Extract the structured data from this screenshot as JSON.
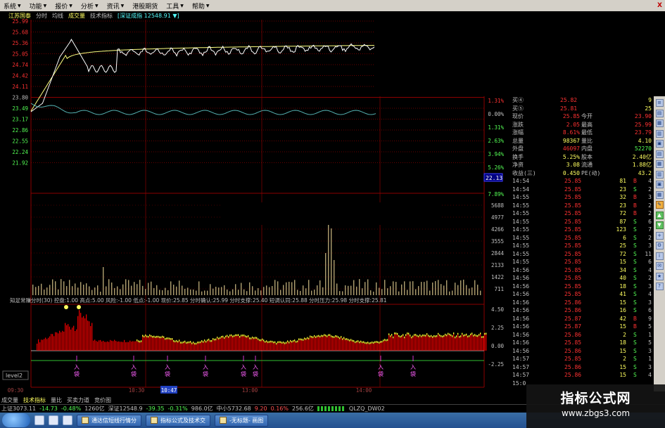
{
  "menu": [
    "系统",
    "功能",
    "报价",
    "分析",
    "资讯",
    "港股期货",
    "工具",
    "帮助"
  ],
  "window_close": "X",
  "chart_header": {
    "stock": "江苏国泰",
    "tabs": [
      "分时",
      "均线",
      "成交量",
      "技术指标"
    ],
    "index_label": "[深证成指 12548.91 ▼]"
  },
  "chart_data": [
    {
      "type": "line",
      "name": "price",
      "price_ticks": [
        "25.99",
        "25.68",
        "25.36",
        "25.05",
        "24.74",
        "24.42",
        "24.11",
        "23.80",
        "23.49",
        "23.17",
        "22.86",
        "22.55",
        "22.24",
        "21.92"
      ],
      "pct_ticks": [
        "1.31%",
        "0.00%",
        "1.31%",
        "2.63%",
        "3.94%",
        "5.26%",
        "",
        "7.89%"
      ],
      "current_value_tag": "22.13",
      "ylim": [
        21.92,
        25.99
      ]
    },
    {
      "type": "bar",
      "name": "volume",
      "ticks": [
        "5688",
        "4977",
        "4266",
        "3555",
        "2844",
        "2133",
        "1422",
        "711"
      ]
    },
    {
      "type": "area",
      "name": "indicator",
      "ticks": [
        "4.50",
        "2.25",
        "0.00",
        "-2.25"
      ],
      "title": "知足常赚分时(30)  控盘:1.00  高点:5.00  风险:-1.00  低点:-1.00  现价:25.85  分时确认:25.99  分时支撑:25.40  短调认同:25.88  分时压力:25.98  分时支撑:25.81",
      "signals": [
        "入袋",
        "入袋",
        "入袋",
        "入袋",
        "入袋",
        "入袋",
        "入袋",
        "入袋",
        "入袋",
        "入袋",
        "入袋"
      ]
    }
  ],
  "time_axis": [
    "09:30",
    "10:30",
    "10:47",
    "13:00",
    "14:00"
  ],
  "level2": "level2",
  "quote": {
    "bid_rows": [
      {
        "label": "买④",
        "price": "25.82",
        "vol": "9"
      },
      {
        "label": "买⑤",
        "price": "25.81",
        "vol": "25"
      }
    ],
    "stats": [
      {
        "l1": "现价",
        "v1": "25.85",
        "l2": "今开",
        "v2": "23.90"
      },
      {
        "l1": "涨跌",
        "v1": "2.05",
        "l2": "最高",
        "v2": "25.99"
      },
      {
        "l1": "涨幅",
        "v1": "8.61%",
        "l2": "最低",
        "v2": "23.79"
      },
      {
        "l1": "总量",
        "v1": "98367",
        "l2": "量比",
        "v2": "4.10"
      },
      {
        "l1": "外盘",
        "v1": "46097",
        "l2": "内盘",
        "v2": "52270"
      },
      {
        "l1": "换手",
        "v1": "5.25%",
        "l2": "股本",
        "v2": "2.40亿"
      },
      {
        "l1": "净资",
        "v1": "3.08",
        "l2": "流通",
        "v2": "1.88亿"
      },
      {
        "l1": "收益(三)",
        "v1": "0.450",
        "l2": "PE(动)",
        "v2": "43.2"
      }
    ],
    "ticks": [
      {
        "t": "14:54",
        "p": "25.85",
        "v": "81",
        "s": "B",
        "n": "4"
      },
      {
        "t": "14:54",
        "p": "25.85",
        "v": "23",
        "s": "S",
        "n": "2"
      },
      {
        "t": "14:55",
        "p": "25.85",
        "v": "32",
        "s": "B",
        "n": "3"
      },
      {
        "t": "14:55",
        "p": "25.85",
        "v": "23",
        "s": "B",
        "n": "2"
      },
      {
        "t": "14:55",
        "p": "25.85",
        "v": "72",
        "s": "B",
        "n": "2"
      },
      {
        "t": "14:55",
        "p": "25.85",
        "v": "87",
        "s": "S",
        "n": "6"
      },
      {
        "t": "14:55",
        "p": "25.85",
        "v": "123",
        "s": "S",
        "n": "7"
      },
      {
        "t": "14:55",
        "p": "25.85",
        "v": "6",
        "s": "S",
        "n": "2"
      },
      {
        "t": "14:55",
        "p": "25.85",
        "v": "25",
        "s": "S",
        "n": "3"
      },
      {
        "t": "14:55",
        "p": "25.85",
        "v": "72",
        "s": "S",
        "n": "11"
      },
      {
        "t": "14:55",
        "p": "25.85",
        "v": "15",
        "s": "S",
        "n": "6"
      },
      {
        "t": "14:56",
        "p": "25.85",
        "v": "34",
        "s": "S",
        "n": "4"
      },
      {
        "t": "14:56",
        "p": "25.85",
        "v": "40",
        "s": "S",
        "n": "2"
      },
      {
        "t": "14:56",
        "p": "25.85",
        "v": "18",
        "s": "S",
        "n": "3"
      },
      {
        "t": "14:56",
        "p": "25.85",
        "v": "41",
        "s": "S",
        "n": "4"
      },
      {
        "t": "14:56",
        "p": "25.86",
        "v": "15",
        "s": "S",
        "n": "3"
      },
      {
        "t": "14:56",
        "p": "25.86",
        "v": "16",
        "s": "S",
        "n": "6"
      },
      {
        "t": "14:56",
        "p": "25.87",
        "v": "42",
        "s": "B",
        "n": "9"
      },
      {
        "t": "14:56",
        "p": "25.87",
        "v": "15",
        "s": "B",
        "n": "5"
      },
      {
        "t": "14:56",
        "p": "25.86",
        "v": "2",
        "s": "S",
        "n": "1"
      },
      {
        "t": "14:56",
        "p": "25.85",
        "v": "18",
        "s": "S",
        "n": "5"
      },
      {
        "t": "14:56",
        "p": "25.86",
        "v": "15",
        "s": "S",
        "n": "3"
      },
      {
        "t": "14:57",
        "p": "25.85",
        "v": "2",
        "s": "S",
        "n": "1"
      },
      {
        "t": "14:57",
        "p": "25.86",
        "v": "15",
        "s": "S",
        "n": "3"
      },
      {
        "t": "14:57",
        "p": "25.86",
        "v": "15",
        "s": "S",
        "n": "4"
      },
      {
        "t": "15:0",
        "p": "",
        "v": "",
        "s": "",
        "n": ""
      }
    ]
  },
  "bottom_tabs": [
    "成交量",
    "技术指标",
    "量比",
    "买卖力道",
    "竞价图"
  ],
  "status": [
    "上证3073.11",
    "-14.73",
    "-0.48%",
    "1260亿",
    "深证12548.9",
    "-39.35",
    "-0.31%",
    "986.0亿",
    "中小5732.68",
    "9.20",
    "0.16%",
    "256.6亿",
    "QLZQ_DW02"
  ],
  "taskbar": [
    "通达信短线行情分",
    "指标公式及技术交",
    "-无标题- 画图"
  ],
  "watermark": {
    "title": "指标公式网",
    "url": "www.zbgs3.com"
  },
  "colors": {
    "up": "#ff3232",
    "down": "#54fcfc",
    "price_line": "#ffffff",
    "avg_line": "#ffff80",
    "grid": "#8b0000",
    "volume": "#b0a070"
  }
}
